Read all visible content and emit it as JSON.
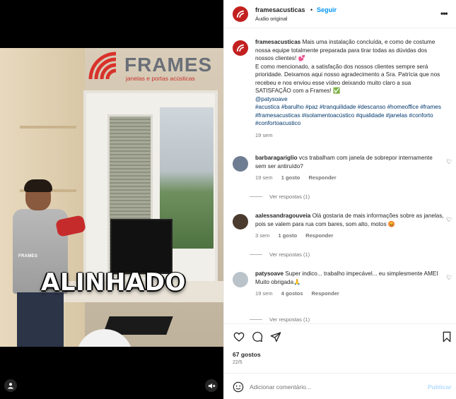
{
  "colors": {
    "accent": "#0095f6",
    "brand_red": "#c2201f",
    "muted": "#737373",
    "text": "#262626"
  },
  "video": {
    "brand": {
      "name": "FRAMES",
      "tagline": "janelas e portas acústicas"
    },
    "shirt_brand": "FRAMES",
    "overlay_caption": "ALINHADO",
    "user_tag_icon": "user-icon",
    "mute_icon": "speaker-muted-icon"
  },
  "header": {
    "username": "framesacusticas",
    "separator": "•",
    "follow_label": "Seguir",
    "audio_label": "Áudio original",
    "more_icon": "more-horizontal-icon"
  },
  "caption": {
    "username": "framesacusticas",
    "text": "Mais uma instalação concluída, e como de costume nossa equipe totalmente preparada para tirar todas as dúvidas dos nossos clientes! 💕",
    "text2": "E como mencionado, a satisfação dos nossos clientes sempre será prioridade. Deixamos aqui nosso agradecimento a Sra. Patrícia que nos recebeu e nos enviou esse vídeo deixando muito claro a sua SATISFAÇÃO com a Frames! ✅",
    "mention": "@patysoave",
    "hashtags": "#acustica #barulho #paz #tranquilidade #descanso #homeoffice #frames #framesacusticas #isolamentoacústico #qualidade #janelas #conforto #confortoacustico",
    "time": "19 sem"
  },
  "comments": [
    {
      "username": "barbaragariglio",
      "text": "vcs trabalham com janela de sobrepor internamente sem ser antiruído?",
      "time": "19 sem",
      "likes": "1 gosto",
      "reply": "Responder",
      "view_replies": "Ver respostas (1)"
    },
    {
      "username": "aalessandragouveia",
      "text": "Olá gostaria de mais informações sobre as janelas, pois se valem para rua com bares, som alto, motos 😡",
      "time": "3 sem",
      "likes": "1 gosto",
      "reply": "Responder",
      "view_replies": "Ver respostas (1)"
    },
    {
      "username": "patysoave",
      "text": "Super indico... trabalho impecável... eu simplesmente AMEI",
      "text2": "Muito obrigada🙏",
      "time": "19 sem",
      "likes": "4 gostos",
      "reply": "Responder",
      "view_replies": "Ver respostas (1)"
    }
  ],
  "actions": {
    "like_icon": "heart-icon",
    "comment_icon": "comment-icon",
    "share_icon": "send-icon",
    "save_icon": "bookmark-icon"
  },
  "likes": "67 gostos",
  "date": "22/5",
  "add_comment": {
    "placeholder": "Adicionar comentário...",
    "publish_label": "Publicar",
    "emoji_icon": "emoji-icon"
  }
}
